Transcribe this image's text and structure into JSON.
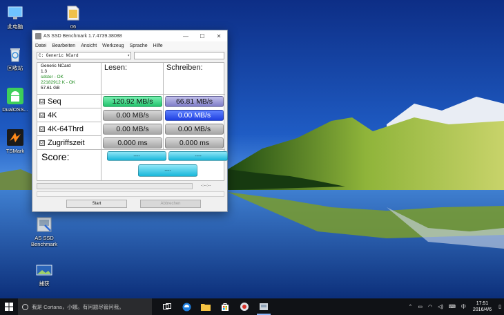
{
  "desktop": {
    "icons": [
      {
        "label": "此电脑"
      },
      {
        "label": "回收站"
      },
      {
        "label": "DualOSS..."
      },
      {
        "label": "TSMark"
      },
      {
        "label": "06"
      },
      {
        "label": "AS SSD\nBenchmark"
      },
      {
        "label": "捕获"
      }
    ]
  },
  "window": {
    "title": "AS SSD Benchmark 1.7.4739.38088",
    "menu": [
      "Datei",
      "Bearbeiten",
      "Ansicht",
      "Werkzeug",
      "Sprache",
      "Hilfe"
    ],
    "drive_select": "C: Generic NCard",
    "drive_info": {
      "name": "Generic NCard",
      "version": "1.3",
      "driver": "sdstor - OK",
      "alignment": "22182912 K - OK",
      "size": "57.61 GB"
    },
    "headers": {
      "read": "Lesen:",
      "write": "Schreiben:"
    },
    "rows": [
      {
        "label": "Seq",
        "checked": true,
        "read": "120.92 MB/s",
        "write": "66.81 MB/s"
      },
      {
        "label": "4K",
        "checked": true,
        "read": "0.00 MB/s",
        "write": "0.00 MB/s"
      },
      {
        "label": "4K-64Thrd",
        "checked": true,
        "read": "0.00 MB/s",
        "write": "0.00 MB/s"
      },
      {
        "label": "Zugriffszeit",
        "checked": true,
        "read": "0.000 ms",
        "write": "0.000 ms"
      }
    ],
    "score": {
      "label": "Score:",
      "read": "----",
      "write": "----",
      "total": "----"
    },
    "timer": "-:--:--",
    "buttons": {
      "start": "Start",
      "abort": "Abbrechen"
    },
    "check_mark": "☑"
  },
  "taskbar": {
    "search_placeholder": "我是 Cortana，小娜。有问题尽管问我。",
    "tray": {
      "lang": "中",
      "time": "17:51",
      "date": "2016/4/6"
    }
  },
  "colors": {
    "seq_read": "#22c26c",
    "seq_write": "#7e7cc8",
    "highlight_write": "#1f3fe0",
    "score": "#17b6da"
  }
}
